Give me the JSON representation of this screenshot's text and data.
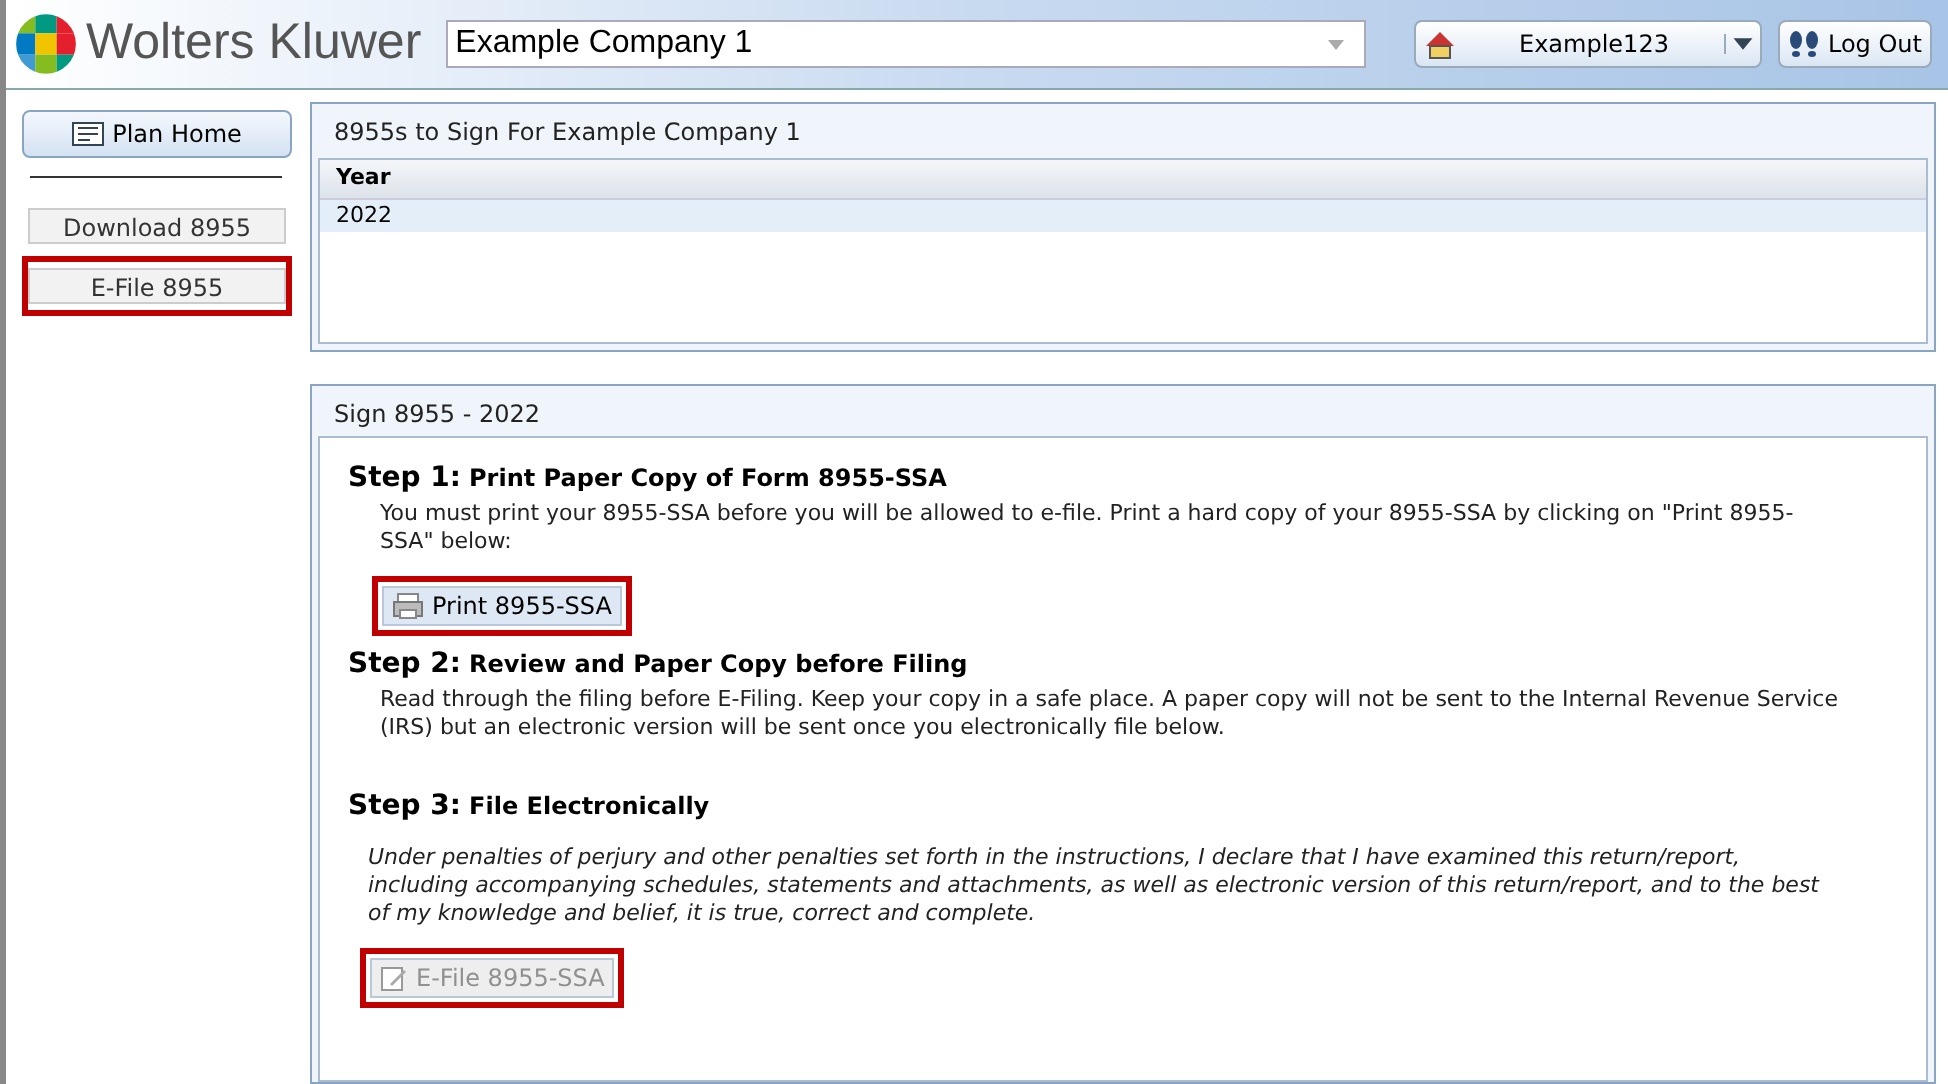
{
  "header": {
    "brand": "Wolters Kluwer",
    "company": "Example Company 1",
    "user": "Example123",
    "logout": "Log Out"
  },
  "sidebar": {
    "home": "Plan Home",
    "items": [
      {
        "label": "Download 8955",
        "highlighted": false
      },
      {
        "label": "E-File 8955",
        "highlighted": true
      }
    ]
  },
  "sign_list": {
    "title": "8955s to Sign For Example Company 1",
    "columns": [
      "Year"
    ],
    "rows": [
      {
        "year": "2022",
        "selected": true
      }
    ]
  },
  "sign_panel": {
    "title": "Sign 8955 - 2022",
    "steps": [
      {
        "kind": "print",
        "number": "Step 1:",
        "title": "Print Paper Copy of Form 8955-SSA",
        "text": "You must print your 8955-SSA before you will be allowed to e-file. Print a hard copy of your 8955-SSA by clicking on \"Print 8955-SSA\" below:",
        "italic": false,
        "button": {
          "label": "Print 8955-SSA",
          "disabled": false,
          "highlighted": true
        }
      },
      {
        "kind": "text",
        "number": "Step 2:",
        "title": "Review and Paper Copy before Filing",
        "text": "Read through the filing before E-Filing. Keep your copy in a safe place. A paper copy will not be sent to the Internal Revenue Service (IRS) but an electronic version will be sent once you electronically file below.",
        "italic": false
      },
      {
        "kind": "efile",
        "number": "Step 3:",
        "title": "File Electronically",
        "text": "Under penalties of perjury and other penalties set forth in the instructions, I declare that I have examined this return/report, including accompanying schedules, statements and attachments, as well as electronic version of this return/report, and to the best of my knowledge and belief, it is true, correct and complete.",
        "italic": true,
        "button": {
          "label": "E-File 8955-SSA",
          "disabled": true,
          "highlighted": true
        }
      }
    ]
  }
}
